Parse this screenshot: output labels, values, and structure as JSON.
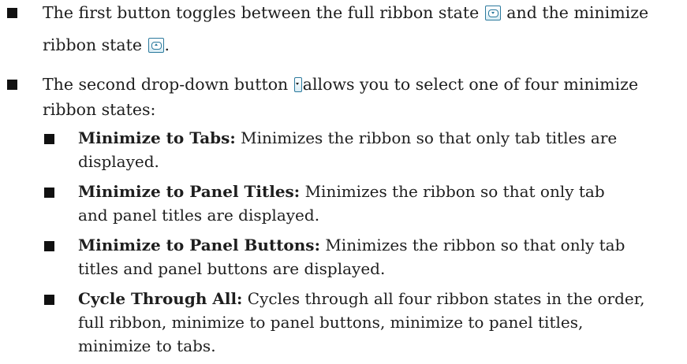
{
  "items": [
    {
      "lines": [
        {
          "pre": "The first button toggles between the full ribbon state",
          "icon": "full-ribbon-icon",
          "post": "and the minimize"
        },
        {
          "pre": "ribbon state",
          "icon": "minimize-ribbon-icon",
          "post": "."
        }
      ]
    },
    {
      "lines": [
        {
          "pre": "The second drop-down button",
          "icon": "dropdown-arrow-icon",
          "post": "allows you to select one of four minimize"
        },
        {
          "pre": "ribbon states:"
        }
      ],
      "subitems": [
        {
          "term": "Minimize to Tabs:",
          "lines": [
            "Minimizes the ribbon so that only tab titles are",
            "displayed."
          ]
        },
        {
          "term": "Minimize to Panel Titles:",
          "lines": [
            "Minimizes the ribbon so that only tab",
            "and panel titles are displayed."
          ]
        },
        {
          "term": "Minimize to Panel Buttons:",
          "lines": [
            "Minimizes the ribbon so that only tab",
            "titles and panel buttons are displayed."
          ]
        },
        {
          "term": "Cycle Through All:",
          "lines": [
            "Cycles through all four ribbon states in the order,",
            "full ribbon, minimize to panel buttons, minimize to panel titles,",
            "minimize to tabs."
          ]
        }
      ]
    }
  ]
}
